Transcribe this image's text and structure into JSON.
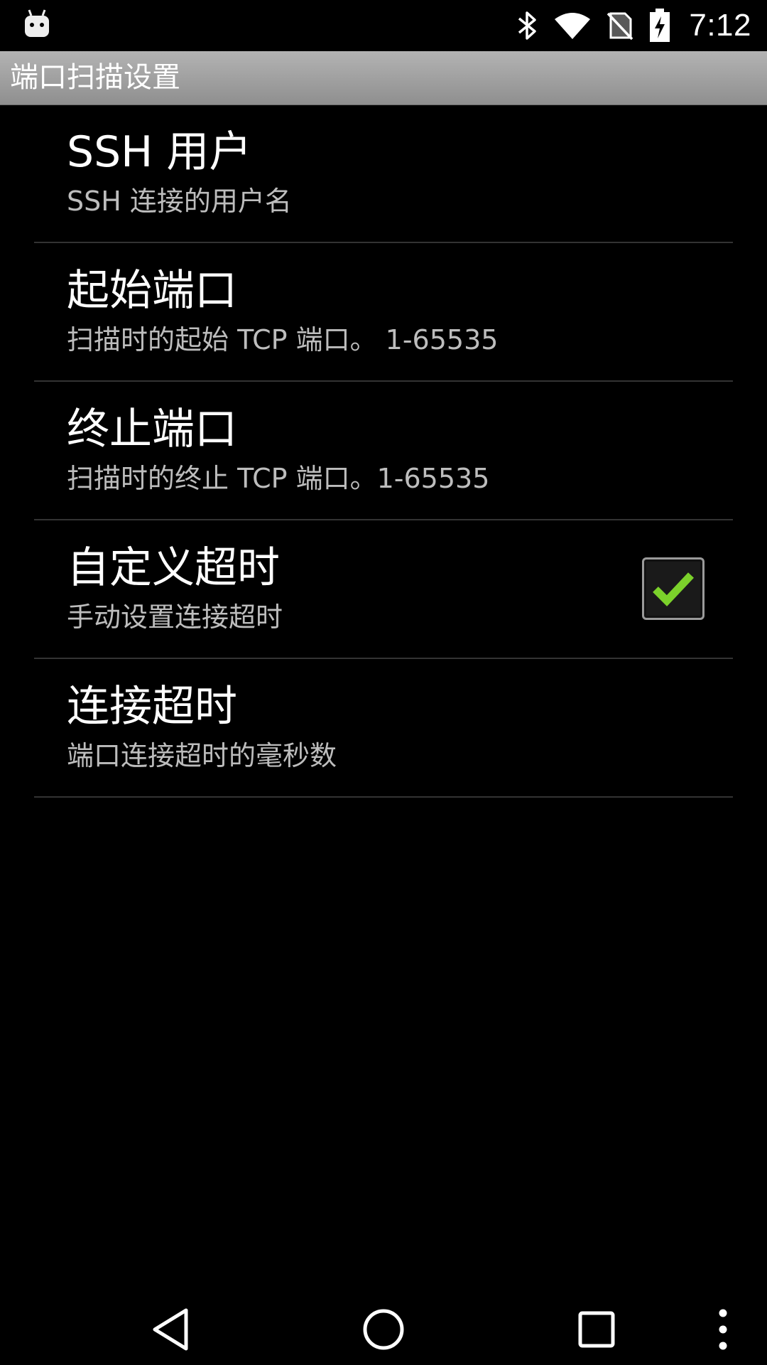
{
  "status_bar": {
    "time": "7:12",
    "icons": [
      "android-notification-icon",
      "bluetooth-icon",
      "wifi-icon",
      "no-sim-icon",
      "battery-charging-icon"
    ]
  },
  "action_bar": {
    "title": "端口扫描设置"
  },
  "preferences": [
    {
      "title": "SSH 用户",
      "summary": "SSH 连接的用户名"
    },
    {
      "title": "起始端口",
      "summary": "扫描时的起始 TCP 端口。 1-65535"
    },
    {
      "title": "终止端口",
      "summary": "扫描时的终止 TCP 端口。1-65535"
    },
    {
      "title": "自定义超时",
      "summary": "手动设置连接超时",
      "checked": true
    },
    {
      "title": "连接超时",
      "summary": "端口连接超时的毫秒数"
    }
  ],
  "colors": {
    "checkmark": "#7bd12b",
    "action_bar": "#a6a6a6",
    "summary_text": "#bdbdbd",
    "divider": "#333333"
  },
  "nav_bar": {
    "buttons": [
      "back-icon",
      "home-icon",
      "recents-icon",
      "overflow-menu-icon"
    ]
  }
}
